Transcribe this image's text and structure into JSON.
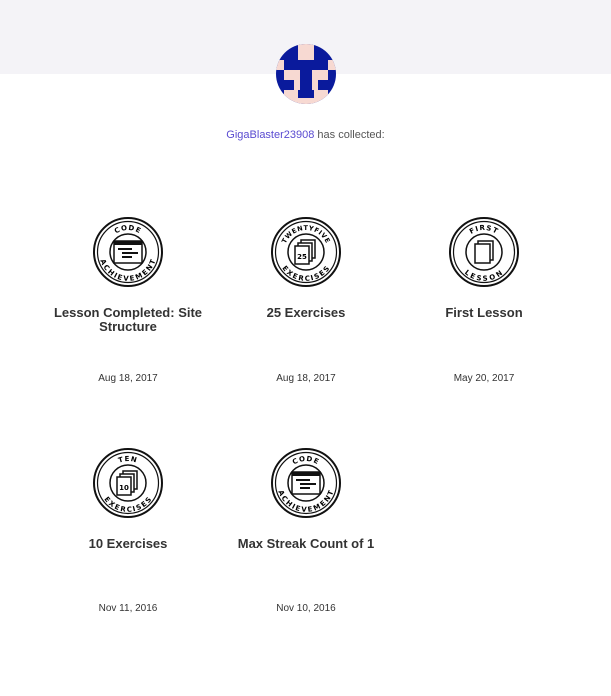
{
  "profile": {
    "username": "GigaBlaster23908",
    "collected_suffix": " has collected:",
    "avatar_colors": {
      "dark": "#0a1a9c",
      "light": "#f7d9d2"
    }
  },
  "badges": [
    {
      "title": "Lesson Completed: Site Structure",
      "date": "Aug 18, 2017",
      "icon": "code-achievement-icon",
      "ring_top": "CODE",
      "ring_bottom": "ACHIEVEMENT"
    },
    {
      "title": "25 Exercises",
      "date": "Aug 18, 2017",
      "icon": "twentyfive-exercises-icon",
      "ring_top": "TWENTYFIVE",
      "ring_bottom": "EXERCISES",
      "number": "25"
    },
    {
      "title": "First Lesson",
      "date": "May 20, 2017",
      "icon": "first-lesson-icon",
      "ring_top": "FIRST",
      "ring_bottom": "LESSON"
    },
    {
      "title": "10 Exercises",
      "date": "Nov 11, 2016",
      "icon": "ten-exercises-icon",
      "ring_top": "TEN",
      "ring_bottom": "EXERCISES",
      "number": "10"
    },
    {
      "title": "Max Streak Count of 1",
      "date": "Nov 10, 2016",
      "icon": "code-achievement-icon",
      "ring_top": "CODE",
      "ring_bottom": "ACHIEVEMENT"
    }
  ]
}
